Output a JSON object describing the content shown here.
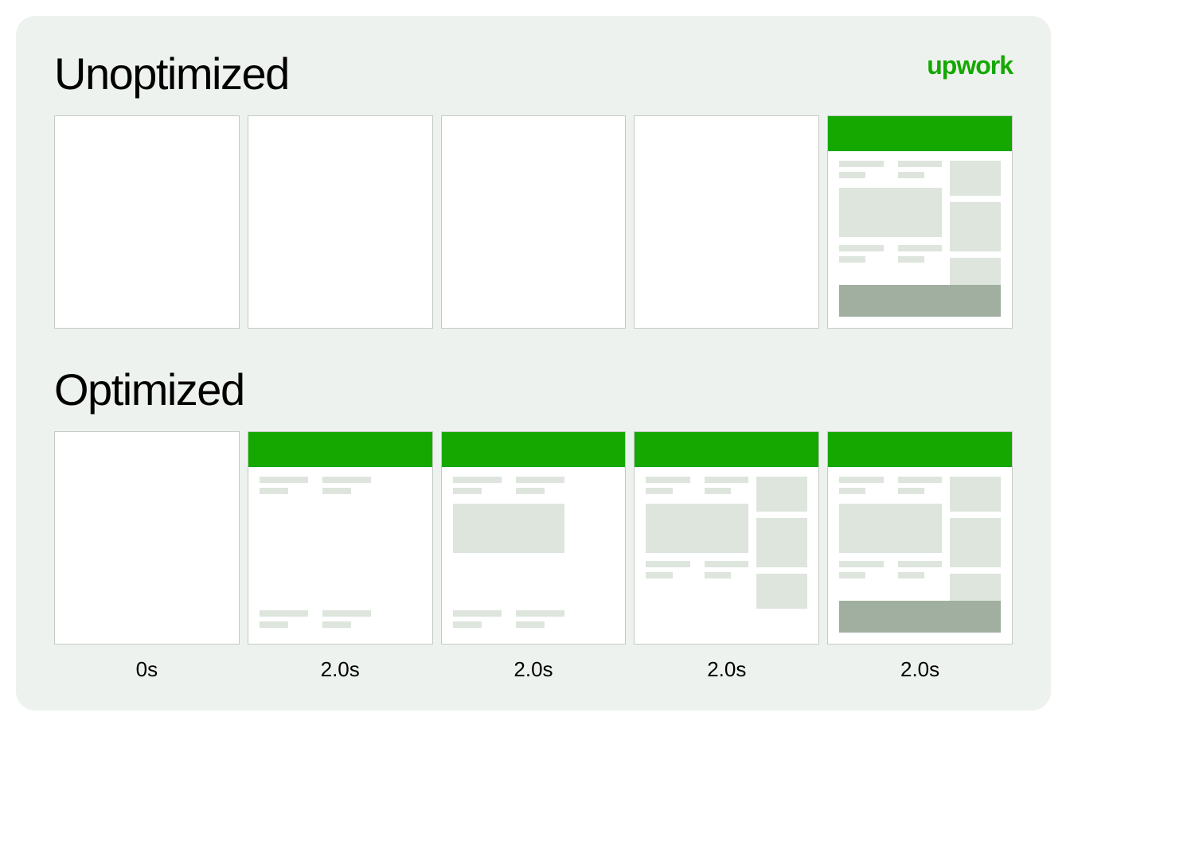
{
  "logo_text": "upwork",
  "sections": {
    "unoptimized": {
      "heading": "Unoptimized",
      "frames": [
        {
          "state": "blank"
        },
        {
          "state": "blank"
        },
        {
          "state": "blank"
        },
        {
          "state": "blank"
        },
        {
          "state": "full"
        }
      ]
    },
    "optimized": {
      "heading": "Optimized",
      "frames": [
        {
          "state": "blank"
        },
        {
          "state": "partial-1"
        },
        {
          "state": "partial-2"
        },
        {
          "state": "partial-3"
        },
        {
          "state": "full"
        }
      ]
    }
  },
  "timeline": [
    "0s",
    "2.0s",
    "2.0s",
    "2.0s",
    "2.0s"
  ],
  "colors": {
    "brand_green": "#14a800",
    "bg_mint": "#eef2ee",
    "skeleton_light": "#dde5dd",
    "skeleton_dark": "#a0af9f"
  }
}
